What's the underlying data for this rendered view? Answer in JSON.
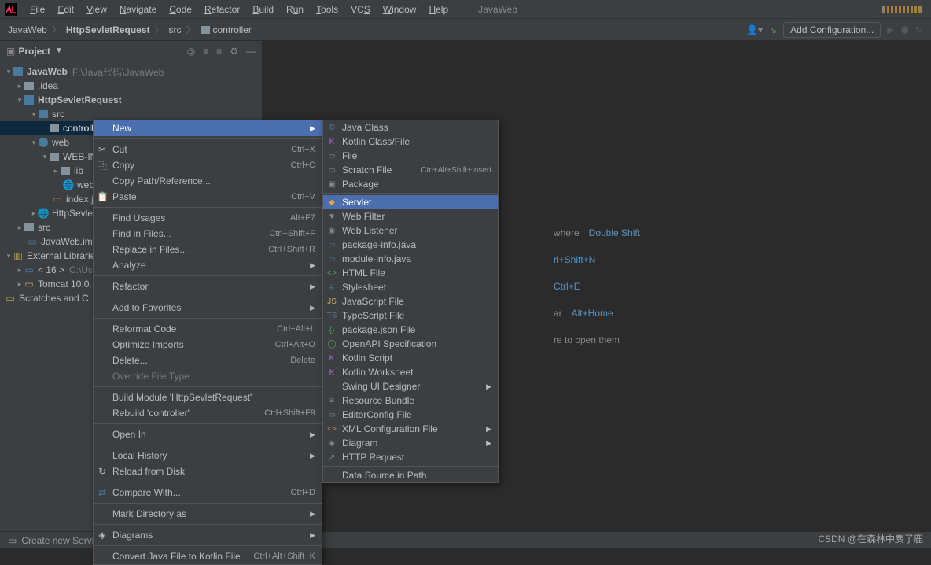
{
  "menubar": {
    "items": [
      "File",
      "Edit",
      "View",
      "Navigate",
      "Code",
      "Refactor",
      "Build",
      "Run",
      "Tools",
      "VCS",
      "Window",
      "Help"
    ],
    "project_hint": "JavaWeb"
  },
  "breadcrumb": {
    "root": "JavaWeb",
    "module": "HttpSevletRequest",
    "src": "src",
    "pkg": "controller"
  },
  "nav": {
    "add_config": "Add Configuration..."
  },
  "sidebar": {
    "title": "Project",
    "tree": {
      "root": {
        "label": "JavaWeb",
        "hint": "F:\\Java代码\\JavaWeb"
      },
      "idea": ".idea",
      "module": "HttpSevletRequest",
      "src": "src",
      "controller": "controller",
      "web": "web",
      "webinf": "WEB-INF",
      "lib": "lib",
      "webxml": "web",
      "indexj": "index.j",
      "httpsevle": "HttpSevle",
      "srcdir": "src",
      "iml": "JavaWeb.iml",
      "ext": "External Librarie",
      "jdk": "< 16 >",
      "jdkhint": "C:\\Us",
      "tomcat": "Tomcat 10.0.",
      "scratches": "Scratches and C"
    }
  },
  "tips": {
    "r1_left": "where",
    "r1_right": "Double Shift",
    "r2_left": "rl+Shift+N",
    "r3_left": "Ctrl+E",
    "r4_left": "ar",
    "r4_right": "Alt+Home",
    "r5": "re to open them"
  },
  "context_menu": {
    "new": "New",
    "items1": [
      {
        "icon": "✂",
        "label": "Cut",
        "shortcut": "Ctrl+X"
      },
      {
        "icon": "⿻",
        "label": "Copy",
        "shortcut": "Ctrl+C"
      },
      {
        "icon": "",
        "label": "Copy Path/Reference...",
        "shortcut": ""
      },
      {
        "icon": "📋",
        "label": "Paste",
        "shortcut": "Ctrl+V"
      }
    ],
    "items2": [
      {
        "label": "Find Usages",
        "shortcut": "Alt+F7"
      },
      {
        "label": "Find in Files...",
        "shortcut": "Ctrl+Shift+F"
      },
      {
        "label": "Replace in Files...",
        "shortcut": "Ctrl+Shift+R"
      },
      {
        "label": "Analyze",
        "arrow": true
      }
    ],
    "refactor": "Refactor",
    "fav": "Add to Favorites",
    "items3": [
      {
        "label": "Reformat Code",
        "shortcut": "Ctrl+Alt+L"
      },
      {
        "label": "Optimize Imports",
        "shortcut": "Ctrl+Alt+O"
      },
      {
        "label": "Delete...",
        "shortcut": "Delete"
      },
      {
        "label": "Override File Type",
        "disabled": true
      }
    ],
    "build_module": "Build Module 'HttpSevletRequest'",
    "rebuild": {
      "label": "Rebuild 'controller'",
      "shortcut": "Ctrl+Shift+F9"
    },
    "open_in": "Open In",
    "history": "Local History",
    "reload": "Reload from Disk",
    "compare": {
      "label": "Compare With...",
      "shortcut": "Ctrl+D"
    },
    "mark": "Mark Directory as",
    "diagrams": "Diagrams",
    "convert": {
      "label": "Convert Java File to Kotlin File",
      "shortcut": "Ctrl+Alt+Shift+K"
    }
  },
  "submenu": {
    "items": [
      {
        "icon": "©",
        "label": "Java Class",
        "color": "#4a7a9e"
      },
      {
        "icon": "K",
        "label": "Kotlin Class/File",
        "color": "#b066d4"
      },
      {
        "icon": "▭",
        "label": "File",
        "color": "#888"
      },
      {
        "icon": "▭",
        "label": "Scratch File",
        "shortcut": "Ctrl+Alt+Shift+Insert",
        "color": "#888"
      },
      {
        "icon": "▣",
        "label": "Package",
        "color": "#87939a"
      },
      {
        "sep": true
      },
      {
        "icon": "◆",
        "label": "Servlet",
        "hl": true,
        "color": "#e8a33d"
      },
      {
        "icon": "▼",
        "label": "Web Filter",
        "color": "#888"
      },
      {
        "icon": "◉",
        "label": "Web Listener",
        "color": "#888"
      },
      {
        "icon": "▭",
        "label": "package-info.java",
        "color": "#4a7a9e"
      },
      {
        "icon": "▭",
        "label": "module-info.java",
        "color": "#4a7a9e"
      },
      {
        "icon": "<>",
        "label": "HTML File",
        "color": "#5a9e5a"
      },
      {
        "icon": "#",
        "label": "Stylesheet",
        "color": "#4a7a9e"
      },
      {
        "icon": "JS",
        "label": "JavaScript File",
        "color": "#c9a94e"
      },
      {
        "icon": "TS",
        "label": "TypeScript File",
        "color": "#4a7a9e"
      },
      {
        "icon": "{}",
        "label": "package.json File",
        "color": "#5a9e5a"
      },
      {
        "icon": "◯",
        "label": "OpenAPI Specification",
        "color": "#5a9e5a"
      },
      {
        "icon": "K",
        "label": "Kotlin Script",
        "color": "#b066d4"
      },
      {
        "icon": "K",
        "label": "Kotlin Worksheet",
        "color": "#b066d4"
      },
      {
        "icon": "",
        "label": "Swing UI Designer",
        "arrow": true
      },
      {
        "icon": "≡",
        "label": "Resource Bundle",
        "color": "#888"
      },
      {
        "icon": "▭",
        "label": "EditorConfig File",
        "color": "#888"
      },
      {
        "icon": "<>",
        "label": "XML Configuration File",
        "arrow": true,
        "color": "#c97b4e"
      },
      {
        "icon": "◈",
        "label": "Diagram",
        "arrow": true,
        "color": "#888"
      },
      {
        "icon": "↗",
        "label": "HTTP Request",
        "color": "#5a9e5a"
      },
      {
        "sep": true
      },
      {
        "icon": "",
        "label": "Data Source in Path"
      }
    ]
  },
  "statusbar": {
    "text": "Create new Servlet"
  },
  "watermark": "CSDN @在森林中麋了鹿"
}
